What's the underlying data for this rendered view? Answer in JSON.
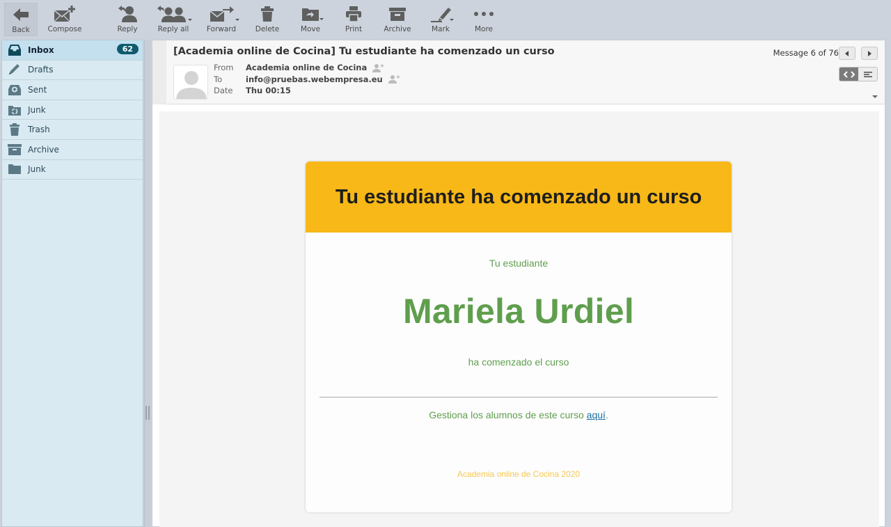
{
  "toolbar": {
    "back": "Back",
    "compose": "Compose",
    "reply": "Reply",
    "reply_all": "Reply all",
    "forward": "Forward",
    "delete": "Delete",
    "move": "Move",
    "print": "Print",
    "archive": "Archive",
    "mark": "Mark",
    "more": "More"
  },
  "sidebar": {
    "folders": [
      {
        "label": "Inbox",
        "icon": "inbox-icon",
        "unread": "62",
        "active": true
      },
      {
        "label": "Drafts",
        "icon": "pencil-icon"
      },
      {
        "label": "Sent",
        "icon": "sent-icon"
      },
      {
        "label": "Junk",
        "icon": "junk-recycle-icon"
      },
      {
        "label": "Trash",
        "icon": "trash-icon"
      },
      {
        "label": "Archive",
        "icon": "archive-icon"
      },
      {
        "label": "Junk",
        "icon": "folder-icon"
      }
    ]
  },
  "message": {
    "subject": "[Academia online de Cocina] Tu estudiante ha comenzado un curso",
    "from_label": "From",
    "from": "Academia online de Cocina",
    "to_label": "To",
    "to": "info@pruebas.webempresa.eu",
    "date_label": "Date",
    "date": "Thu 00:15",
    "counter": "Message 6 of 76"
  },
  "email": {
    "header_color": "#f8b817",
    "accent_green": "#5f9e4d",
    "title": "Tu estudiante ha comenzado un curso",
    "intro": "Tu estudiante",
    "student_name": "Mariela Urdiel",
    "action": "ha comenzado el curso",
    "manage_text": "Gestiona los alumnos de este curso ",
    "manage_link": "aquí",
    "manage_end": ".",
    "footer": "Academia online de Cocina 2020"
  }
}
